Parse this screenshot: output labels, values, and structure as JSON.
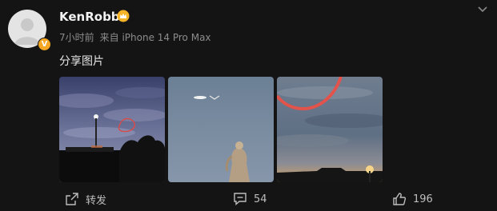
{
  "post": {
    "username": "KenRobb",
    "time": "7小时前",
    "source": "来自 iPhone 14 Pro Max",
    "text": "分享图片",
    "avatar_badge": "V",
    "badge_color": "#f5a623",
    "images": [
      {
        "scene": "cloudy-sky-street-lamp-trees-red-circle"
      },
      {
        "scene": "overcast-sky-statue-bright-object"
      },
      {
        "scene": "cloudy-sky-sunset-red-arc"
      }
    ]
  },
  "actions": {
    "repost_label": "转发",
    "comment_count": "54",
    "like_count": "196"
  },
  "icons": {
    "vip": "crown-badge-icon",
    "menu": "chevron-down-icon",
    "repost": "share-icon",
    "comment": "comment-icon",
    "like": "thumbs-up-icon"
  }
}
